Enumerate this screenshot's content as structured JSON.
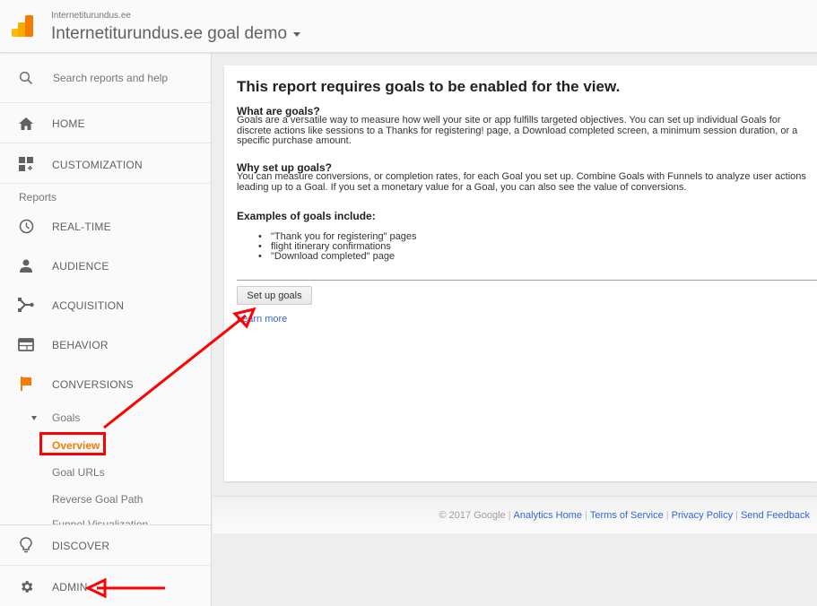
{
  "header": {
    "account_subtitle": "Internetiturundus.ee",
    "view_title": "Internetiturundus.ee goal demo"
  },
  "sidebar": {
    "search_placeholder": "Search reports and help",
    "home": "HOME",
    "customization": "CUSTOMIZATION",
    "reports_heading": "Reports",
    "items": [
      {
        "label": "REAL-TIME",
        "icon": "clock-icon"
      },
      {
        "label": "AUDIENCE",
        "icon": "person-icon"
      },
      {
        "label": "ACQUISITION",
        "icon": "acquisition-icon"
      },
      {
        "label": "BEHAVIOR",
        "icon": "behavior-icon"
      },
      {
        "label": "CONVERSIONS",
        "icon": "flag-icon"
      }
    ],
    "goals_label": "Goals",
    "goals_sub": [
      {
        "label": "Overview",
        "active": true
      },
      {
        "label": "Goal URLs",
        "active": false
      },
      {
        "label": "Reverse Goal Path",
        "active": false
      },
      {
        "label": "Funnel Visualization",
        "active": false
      }
    ],
    "discover": "DISCOVER",
    "admin": "ADMIN",
    "accent_color": "#f57c00"
  },
  "main": {
    "title": "This report requires goals to be enabled for the view.",
    "what_heading": "What are goals?",
    "what_text": "Goals are a versatile way to measure how well your site or app fulfills targeted objectives. You can set up individual Goals for discrete actions like sessions to a Thanks for registering! page, a Download completed screen, a minimum session duration, or a specific purchase amount.",
    "why_heading": "Why set up goals?",
    "why_text": "You can measure conversions, or completion rates, for each Goal you set up. Combine Goals with Funnels to analyze user actions leading up to a Goal. If you set a monetary value for a Goal, you can also see the value of conversions.",
    "examples_heading": "Examples of goals include:",
    "examples": [
      "\"Thank you for registering\" pages",
      "flight itinerary confirmations",
      "\"Download completed\" page"
    ],
    "setup_button": "Set up goals",
    "learn_more": "Learn more"
  },
  "footer": {
    "copyright": "© 2017 Google",
    "links": [
      "Analytics Home",
      "Terms of Service",
      "Privacy Policy",
      "Send Feedback"
    ],
    "link_color": "#3367d6"
  },
  "annotations": {
    "color": "#ff0000"
  }
}
